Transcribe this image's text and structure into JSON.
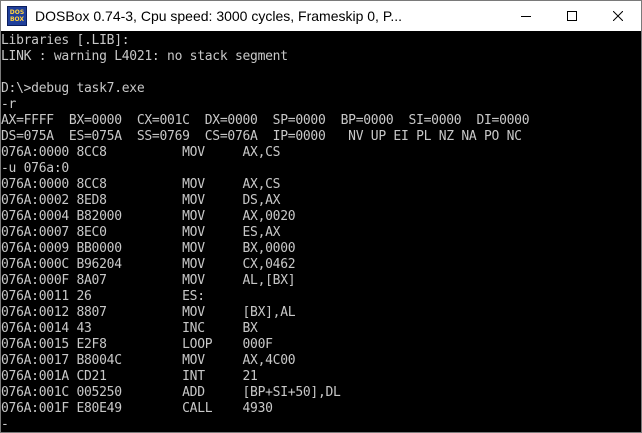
{
  "window": {
    "title": "DOSBox 0.74-3, Cpu speed:     3000 cycles, Frameskip  0, P...",
    "icon_text_top": "DOS",
    "icon_text_bottom": "BOX"
  },
  "console_lines": [
    "Libraries [.LIB]:",
    "LINK : warning L4021: no stack segment",
    "",
    "D:\\>debug task7.exe",
    "-r",
    "AX=FFFF  BX=0000  CX=001C  DX=0000  SP=0000  BP=0000  SI=0000  DI=0000",
    "DS=075A  ES=075A  SS=0769  CS=076A  IP=0000   NV UP EI PL NZ NA PO NC",
    "076A:0000 8CC8          MOV     AX,CS",
    "-u 076a:0",
    "076A:0000 8CC8          MOV     AX,CS",
    "076A:0002 8ED8          MOV     DS,AX",
    "076A:0004 B82000        MOV     AX,0020",
    "076A:0007 8EC0          MOV     ES,AX",
    "076A:0009 BB0000        MOV     BX,0000",
    "076A:000C B96204        MOV     CX,0462",
    "076A:000F 8A07          MOV     AL,[BX]",
    "076A:0011 26            ES:",
    "076A:0012 8807          MOV     [BX],AL",
    "076A:0014 43            INC     BX",
    "076A:0015 E2F8          LOOP    000F",
    "076A:0017 B8004C        MOV     AX,4C00",
    "076A:001A CD21          INT     21",
    "076A:001C 005250        ADD     [BP+SI+50],DL",
    "076A:001F E80E49        CALL    4930",
    "-"
  ],
  "icons": {
    "minimize": "minimize-icon",
    "maximize": "maximize-icon",
    "close": "close-icon"
  },
  "colors": {
    "console_bg": "#000000",
    "console_fg": "#c8c8c8",
    "titlebar_bg": "#ffffff"
  }
}
